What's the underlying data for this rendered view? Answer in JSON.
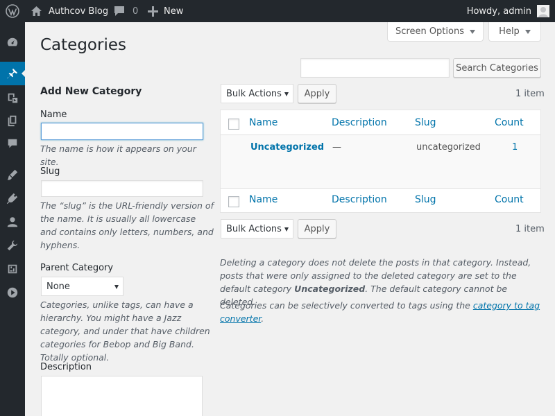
{
  "adminbar": {
    "site_name": "Authcov Blog",
    "comments_count": "0",
    "new_label": "New",
    "greeting": "Howdy, admin"
  },
  "sidebar": {
    "items": [
      {
        "name": "dashboard",
        "icon": "dashboard-icon"
      },
      {
        "name": "posts",
        "icon": "pushpin-icon",
        "current": true
      },
      {
        "name": "media",
        "icon": "media-icon"
      },
      {
        "name": "pages",
        "icon": "pages-icon"
      },
      {
        "name": "comments",
        "icon": "comments-icon"
      },
      {
        "name": "appearance",
        "icon": "appearance-icon"
      },
      {
        "name": "plugins",
        "icon": "plugins-icon"
      },
      {
        "name": "users",
        "icon": "users-icon"
      },
      {
        "name": "tools",
        "icon": "tools-icon"
      },
      {
        "name": "settings",
        "icon": "settings-icon"
      },
      {
        "name": "collapse",
        "icon": "collapse-icon"
      }
    ]
  },
  "screen_options_label": "Screen Options",
  "help_label": "Help",
  "page_title": "Categories",
  "form": {
    "heading": "Add New Category",
    "name_label": "Name",
    "name_value": "",
    "name_hint": "The name is how it appears on your site.",
    "slug_label": "Slug",
    "slug_value": "",
    "slug_hint": "The “slug” is the URL-friendly version of the name. It is usually all lowercase and contains only letters, numbers, and hyphens.",
    "parent_label": "Parent Category",
    "parent_value": "None",
    "parent_hint": "Categories, unlike tags, can have a hierarchy. You might have a Jazz category, and under that have children categories for Bebop and Big Band. Totally optional.",
    "description_label": "Description"
  },
  "search": {
    "value": "",
    "button_label": "Search Categories"
  },
  "bulk": {
    "label": "Bulk Actions",
    "apply_label": "Apply",
    "count": "1 item"
  },
  "table": {
    "columns": [
      "Name",
      "Description",
      "Slug",
      "Count"
    ],
    "rows": [
      {
        "name": "Uncategorized",
        "description": "—",
        "slug": "uncategorized",
        "count": "1"
      }
    ]
  },
  "notes": {
    "note1_part1": "Deleting a category does not delete the posts in that category. Instead, posts that were only assigned to the deleted category are set to the default category ",
    "note1_bold": "Uncategorized",
    "note1_part2": ". The default category cannot be deleted.",
    "note2_part1": "Categories can be selectively converted to tags using the ",
    "note2_link": "category to tag converter",
    "note2_part2": "."
  },
  "colors": {
    "adminbar": "#23282d",
    "accent": "#0073aa",
    "background": "#f1f1f1"
  }
}
